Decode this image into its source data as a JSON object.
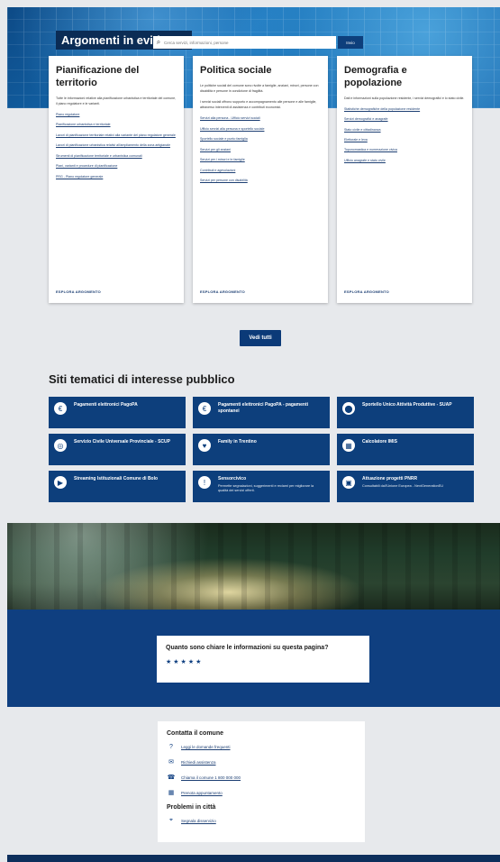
{
  "hero": {
    "title": "Argomenti in evidenza",
    "cards": [
      {
        "title": "Pianificazione del territorio",
        "desc": "Tutte le informazioni relative alla pianificazione urbanistica e territoriale del comune, il piano regolatore e le varianti.",
        "items": [
          "Piano regolatore",
          "Pianificazione urbanistica e territoriale",
          "Lavori di pianificazione territoriale relativi alla variante del piano regolatore generale",
          "Lavori di pianificazione urbanistica relativi all'ampliamento della zona artigianale",
          "Strumenti di pianificazione territoriale e urbanistica comunali",
          "Piani, varianti e procedure di pianificazione",
          "PRG - Piano regolatore generale"
        ],
        "explore": "ESPLORA ARGOMENTO"
      },
      {
        "title": "Politica sociale",
        "desc": "Le politiche sociali del comune sono rivolte a famiglie, anziani, minori, persone con disabilità e persone in condizione di fragilità.",
        "desc2": "I servizi sociali offrono supporto e accompagnamento alle persone e alle famiglie, attraverso interventi di assistenza e contributi economici.",
        "items": [
          "Servizi alla persona - Ufficio servizi sociali",
          "Ufficio servizi alla persona e sportello sociale",
          "Sportello sociale e punto famiglia",
          "Servizi per gli anziani",
          "Servizi per i minori e le famiglie",
          "Contributi e agevolazioni",
          "Servizi per persone con disabilità"
        ],
        "explore": "ESPLORA ARGOMENTO"
      },
      {
        "title": "Demografia e popolazione",
        "desc": "Dati e informazioni sulla popolazione residente, i servizi demografici e lo stato civile.",
        "items": [
          "Statistiche demografiche della popolazione residente",
          "Servizi demografici e anagrafe",
          "Stato civile e cittadinanza",
          "Elettorale e leva",
          "Toponomastica e numerazione civica",
          "Ufficio anagrafe e stato civile"
        ],
        "explore": "ESPLORA ARGOMENTO"
      }
    ],
    "see_all": "Vedi tutti"
  },
  "sites": {
    "title": "Siti tematici di interesse pubblico",
    "items": [
      {
        "name": "Pagamenti elettronici PagoPA",
        "desc": "",
        "icon": "pagopa-icon"
      },
      {
        "name": "Pagamenti elettronici PagoPA - pagamenti spontanei",
        "desc": "",
        "icon": "pagopa-icon"
      },
      {
        "name": "Sportello Unico Attività Produttive - SUAP",
        "desc": "",
        "icon": "suap-icon"
      },
      {
        "name": "Servizio Civile Universale Provinciale - SCUP",
        "desc": "",
        "icon": "scup-icon"
      },
      {
        "name": "Family in Trentino",
        "desc": "",
        "icon": "family-icon"
      },
      {
        "name": "Calcolatore IMIS",
        "desc": "",
        "icon": "calculator-icon"
      },
      {
        "name": "Streaming Istituzionali Comune di Bolo",
        "desc": "",
        "icon": "stream-icon"
      },
      {
        "name": "Sensorcivico",
        "desc": "Permette segnalazioni, suggerimenti e reclami per migliorare la qualità dei servizi offerti.",
        "icon": "sensorcivico-icon"
      },
      {
        "name": "Attuazione progetti PNRR",
        "desc": "Consultabili dall'Unione Europea - NextGenerationEU",
        "icon": "pnrr-icon"
      }
    ]
  },
  "search": {
    "placeholder": "Cerca servizi, informazioni, persone",
    "button": "Invio"
  },
  "rating": {
    "question": "Quanto sono chiare le informazioni su questa pagina?",
    "stars": "★★★★★"
  },
  "contact": {
    "title": "Contatta il comune",
    "links": [
      {
        "label": "Leggi le domande frequenti",
        "icon": "help-icon"
      },
      {
        "label": "Richiedi assistenza",
        "icon": "mail-icon"
      },
      {
        "label": "Chiama il comune 1 800 000 000",
        "icon": "phone-icon"
      },
      {
        "label": "Prenota appuntamento",
        "icon": "calendar-icon"
      }
    ],
    "problems_title": "Problemi in città",
    "problems_links": [
      {
        "label": "Segnala disservizio",
        "icon": "pin-icon"
      }
    ]
  },
  "colors": {
    "primary": "#0d3f7c",
    "panel": "#0f3f80"
  }
}
